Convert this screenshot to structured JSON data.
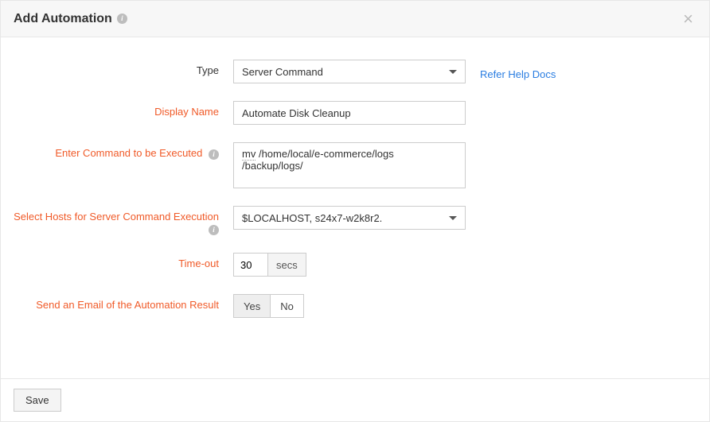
{
  "header": {
    "title": "Add Automation"
  },
  "helpLink": "Refer Help Docs",
  "labels": {
    "type": "Type",
    "displayName": "Display Name",
    "command": "Enter Command to be Executed",
    "hosts": "Select Hosts for Server Command Execution",
    "timeout": "Time-out",
    "emailResult": "Send an Email of the Automation Result"
  },
  "fields": {
    "typeValue": "Server Command",
    "displayNameValue": "Automate Disk Cleanup",
    "commandValue": "mv /home/local/e-commerce/logs /backup/logs/",
    "hostsValue": "$LOCALHOST, s24x7-w2k8r2.",
    "timeoutValue": "30",
    "timeoutUnit": "secs"
  },
  "toggles": {
    "yes": "Yes",
    "no": "No",
    "selected": "yes"
  },
  "footer": {
    "save": "Save"
  }
}
